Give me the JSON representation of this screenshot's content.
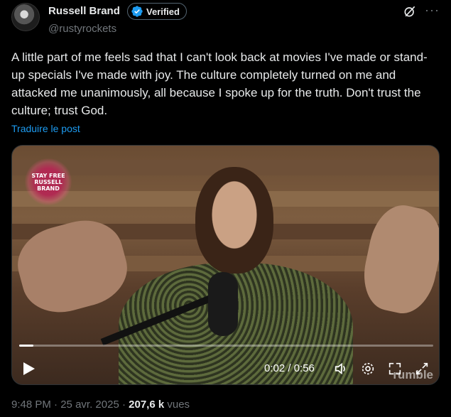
{
  "author": {
    "name": "Russell Brand",
    "verified_label": "Verified",
    "handle": "@rustyrockets"
  },
  "icons": {
    "verified": "verified-check-icon",
    "grok": "grok-icon",
    "more": "more-icon",
    "play": "play-icon",
    "volume": "volume-icon",
    "settings": "gear-icon",
    "pip": "picture-in-picture-icon",
    "fullscreen": "fullscreen-icon"
  },
  "tweet": {
    "text": "A little part of me feels sad that I can't look back at movies I've made or stand-up specials I've made with joy. The culture completely turned on me and attacked me unanimously, all because I spoke up for the truth. Don't trust the culture; trust God.",
    "translate_label": "Traduire le post"
  },
  "video": {
    "overlay_logo_line1": "STAY FREE",
    "overlay_logo_line2": "RUSSELL",
    "overlay_logo_line3": "BRAND",
    "time_display": "0:02 / 0:56",
    "progress_fraction": 0.035,
    "watermark": "rumble"
  },
  "meta": {
    "time": "9:48 PM",
    "date": "25 avr. 2025",
    "views_count": "207,6 k",
    "views_label": "vues"
  },
  "colors": {
    "link": "#1d9bf0",
    "verified_blue": "#1d9bf0",
    "muted": "#71767b"
  }
}
